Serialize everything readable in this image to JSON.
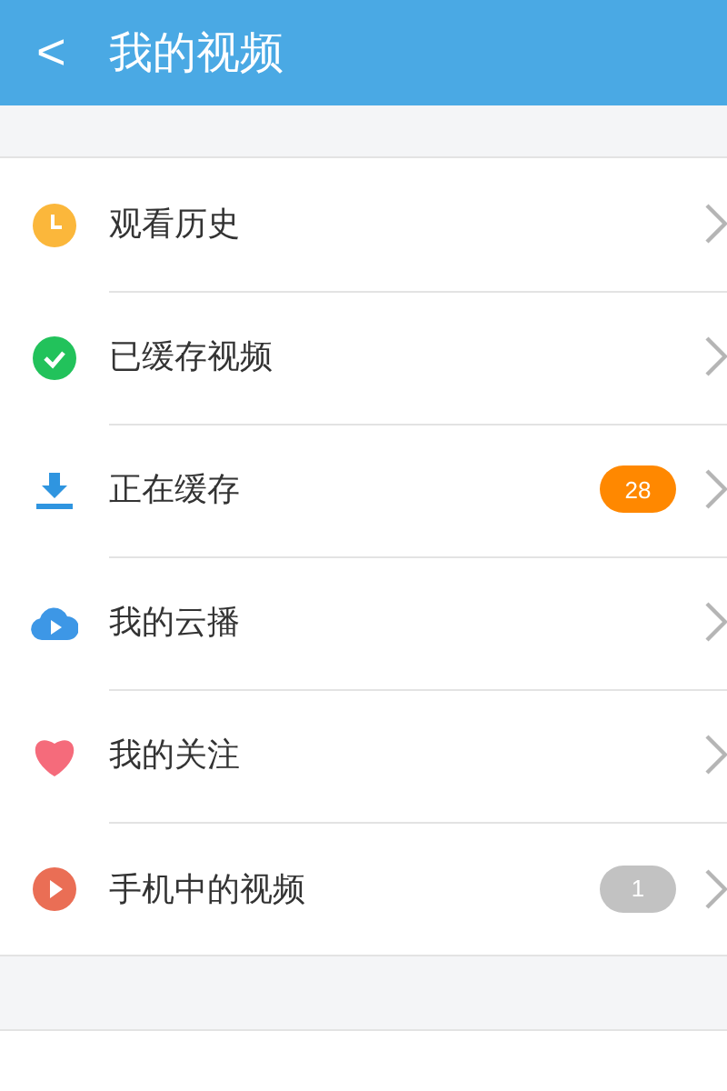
{
  "header": {
    "back": "<",
    "title": "我的视频"
  },
  "items": [
    {
      "kind": "history",
      "label": "观看历史"
    },
    {
      "kind": "cached",
      "label": "已缓存视频"
    },
    {
      "kind": "downloading",
      "label": "正在缓存",
      "badge": {
        "text": "28",
        "color": "#ff8800"
      }
    },
    {
      "kind": "cloud",
      "label": "我的云播"
    },
    {
      "kind": "follow",
      "label": "我的关注"
    },
    {
      "kind": "local",
      "label": "手机中的视频",
      "badge": {
        "text": "1",
        "color": "#c2c2c2"
      }
    }
  ]
}
